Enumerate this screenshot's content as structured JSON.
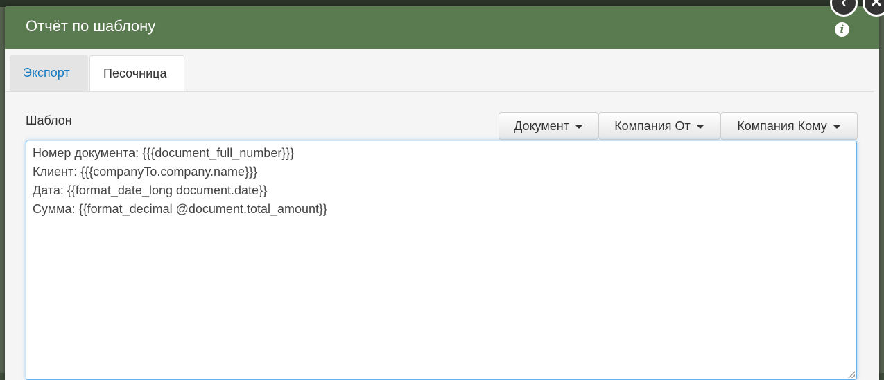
{
  "dialog": {
    "title": "Отчёт по шаблону",
    "info_icon": "i"
  },
  "tabs": [
    {
      "label": "Экспорт",
      "active": false
    },
    {
      "label": "Песочница",
      "active": true
    }
  ],
  "template_section": {
    "label": "Шаблон",
    "buttons": [
      {
        "label": "Документ"
      },
      {
        "label": "Компания От"
      },
      {
        "label": "Компания Кому"
      }
    ],
    "lines": [
      "Номер документа: {{{document_full_number}}}",
      "Клиент: {{{companyTo.company.name}}}",
      "Дата: {{format_date_long document.date}}",
      "Сумма: {{format_decimal @document.total_amount}}"
    ]
  },
  "overlay_buttons": {
    "back_icon": "‹",
    "close_icon": "✕"
  },
  "colors": {
    "header": "#5a7a50",
    "link": "#1a7bbf",
    "focus_border": "#66afe9"
  }
}
